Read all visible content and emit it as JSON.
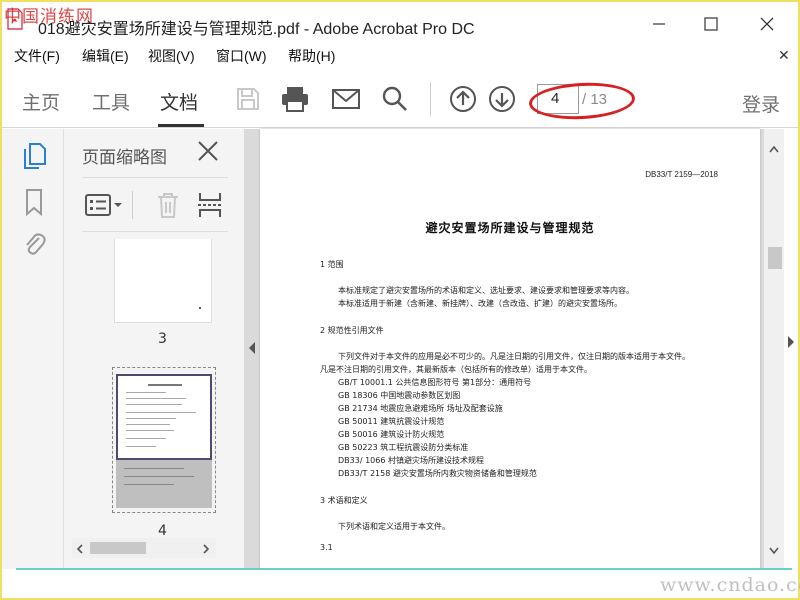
{
  "watermark_top": "中国消练网",
  "watermark_bottom": "www.cndao.com",
  "window": {
    "title": "018避灾安置场所建设与管理规范.pdf - Adobe Acrobat Pro DC"
  },
  "menu": {
    "items": [
      "文件(F)",
      "编辑(E)",
      "视图(V)",
      "窗口(W)",
      "帮助(H)"
    ]
  },
  "toolbar": {
    "tabs": [
      "主页",
      "工具",
      "文档"
    ],
    "active_tab": "文档",
    "current_page": "4",
    "total_pages": "/ 13",
    "login": "登录"
  },
  "thumb_panel": {
    "title": "页面缩略图",
    "pages": [
      "3",
      "4"
    ]
  },
  "document": {
    "code": "DB33/T 2159—2018",
    "title": "避灾安置场所建设与管理规范",
    "lines": [
      "1  范围",
      "本标准规定了避灾安置场所的术语和定义、选址要求、建设要求和管理要求等内容。",
      "本标准适用于新建（含新建、新挂牌）、改建（含改造、扩建）的避灾安置场所。",
      "2  规范性引用文件",
      "下列文件对于本文件的应用是必不可少的。凡是注日期的引用文件，仅注日期的版本适用于本文件。",
      "凡是不注日期的引用文件，其最新版本（包括所有的修改单）适用于本文件。",
      "GB/T 10001.1  公共信息图形符号  第1部分：通用符号",
      "GB 18306  中国地震动参数区划图",
      "GB 21734  地震应急避难场所  场址及配套设施",
      "GB 50011  建筑抗震设计规范",
      "GB 50016  建筑设计防火规范",
      "GB 50223  筑工程抗震设防分类标准",
      "DB33/ 1066  村镇避灾场所建设技术规程",
      "DB33/T 2158  避灾安置场所内救灾物资储备和管理规范",
      "3  术语和定义",
      "下列术语和定义适用于本文件。",
      "3.1"
    ]
  }
}
